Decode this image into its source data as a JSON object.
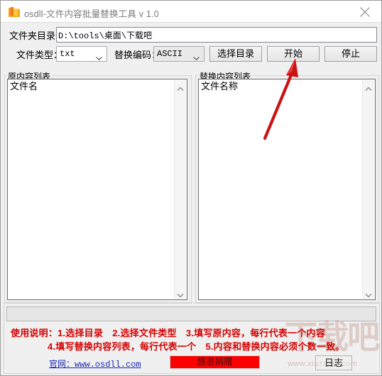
{
  "window": {
    "title": "osdll-文件内容批量替换工具 v 1.0",
    "icon": "folder-icon",
    "close_label": "close-icon"
  },
  "form": {
    "dir_label": "文件夹目录：",
    "dir_value": "D:\\tools\\桌面\\下载吧",
    "dir_placeholder": "",
    "type_label": "文件类型：",
    "type_value": "txt",
    "encoding_label": "替换编码：",
    "encoding_value": "ASCII",
    "buttons": {
      "choose_dir": "选择目录",
      "start": "开始",
      "stop": "停止"
    }
  },
  "panels": {
    "left": {
      "group_title": "原内容列表",
      "first_item": "文件名"
    },
    "right": {
      "group_title": "替换内容列表",
      "first_item": "文件名称"
    }
  },
  "status": {
    "progress_value": ""
  },
  "footer": {
    "help_line_1": "使用说明：1.选择目录　2.选择文件类型　3.填写原内容，每行代表一个内容",
    "help_line_2": "4.填写替换内容列表，每行代表一个　5.内容和替换内容必须个数一致。",
    "site_link": "官网：www.osdll.com",
    "donate_label": "感恩捐赠",
    "log_label": "日志"
  },
  "watermark": {
    "big": "下载吧",
    "small": "www.xiazaiba.com"
  },
  "annotation": {
    "arrow_color": "#cc1111",
    "points_at": "开始"
  },
  "colors": {
    "accent_red": "#d40000",
    "donate_bg": "#fd0000",
    "link": "#1a27b8",
    "window_bg": "#f0f0f0",
    "titlebar_bg": "#ffffff"
  }
}
